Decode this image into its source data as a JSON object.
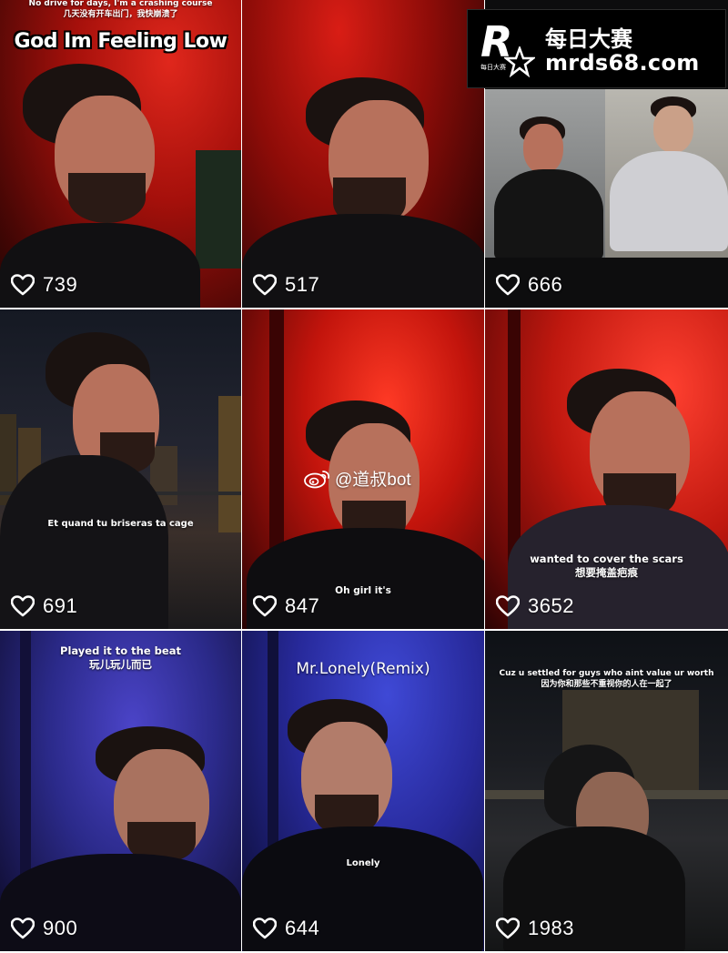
{
  "logo": {
    "mark": "R",
    "mark_sub": "每日大赛",
    "title_cn": "每日大赛",
    "url": "mrds68.com"
  },
  "watermark": {
    "icon": "weibo-icon",
    "handle": "@道叔bot"
  },
  "colors": {
    "heart": "#ffffff",
    "text": "#ffffff",
    "red_bg": "#b3130c",
    "blue_bg": "#2b2a8a"
  },
  "tiles": [
    {
      "likes": "739",
      "caption_top": "No drive for days, I'm a crashing course",
      "caption_top_cn": "几天没有开车出门，我快崩溃了",
      "caption_big": "God Im Feeling Low"
    },
    {
      "likes": "517"
    },
    {
      "likes": "666"
    },
    {
      "likes": "691",
      "caption": "Et quand tu briseras ta cage"
    },
    {
      "likes": "847",
      "caption": "Oh girl it's"
    },
    {
      "likes": "3652",
      "caption": "wanted to cover the scars",
      "caption_cn": "想要掩盖疤痕"
    },
    {
      "likes": "900",
      "caption": "Played it to the beat",
      "caption_cn": "玩儿玩儿而已"
    },
    {
      "likes": "644",
      "title": "Mr.Lonely(Remix)",
      "caption": "Lonely"
    },
    {
      "likes": "1983",
      "caption": "Cuz u settled for guys who aint value ur worth",
      "caption_cn": "因为你和那些不重视你的人在一起了"
    }
  ]
}
